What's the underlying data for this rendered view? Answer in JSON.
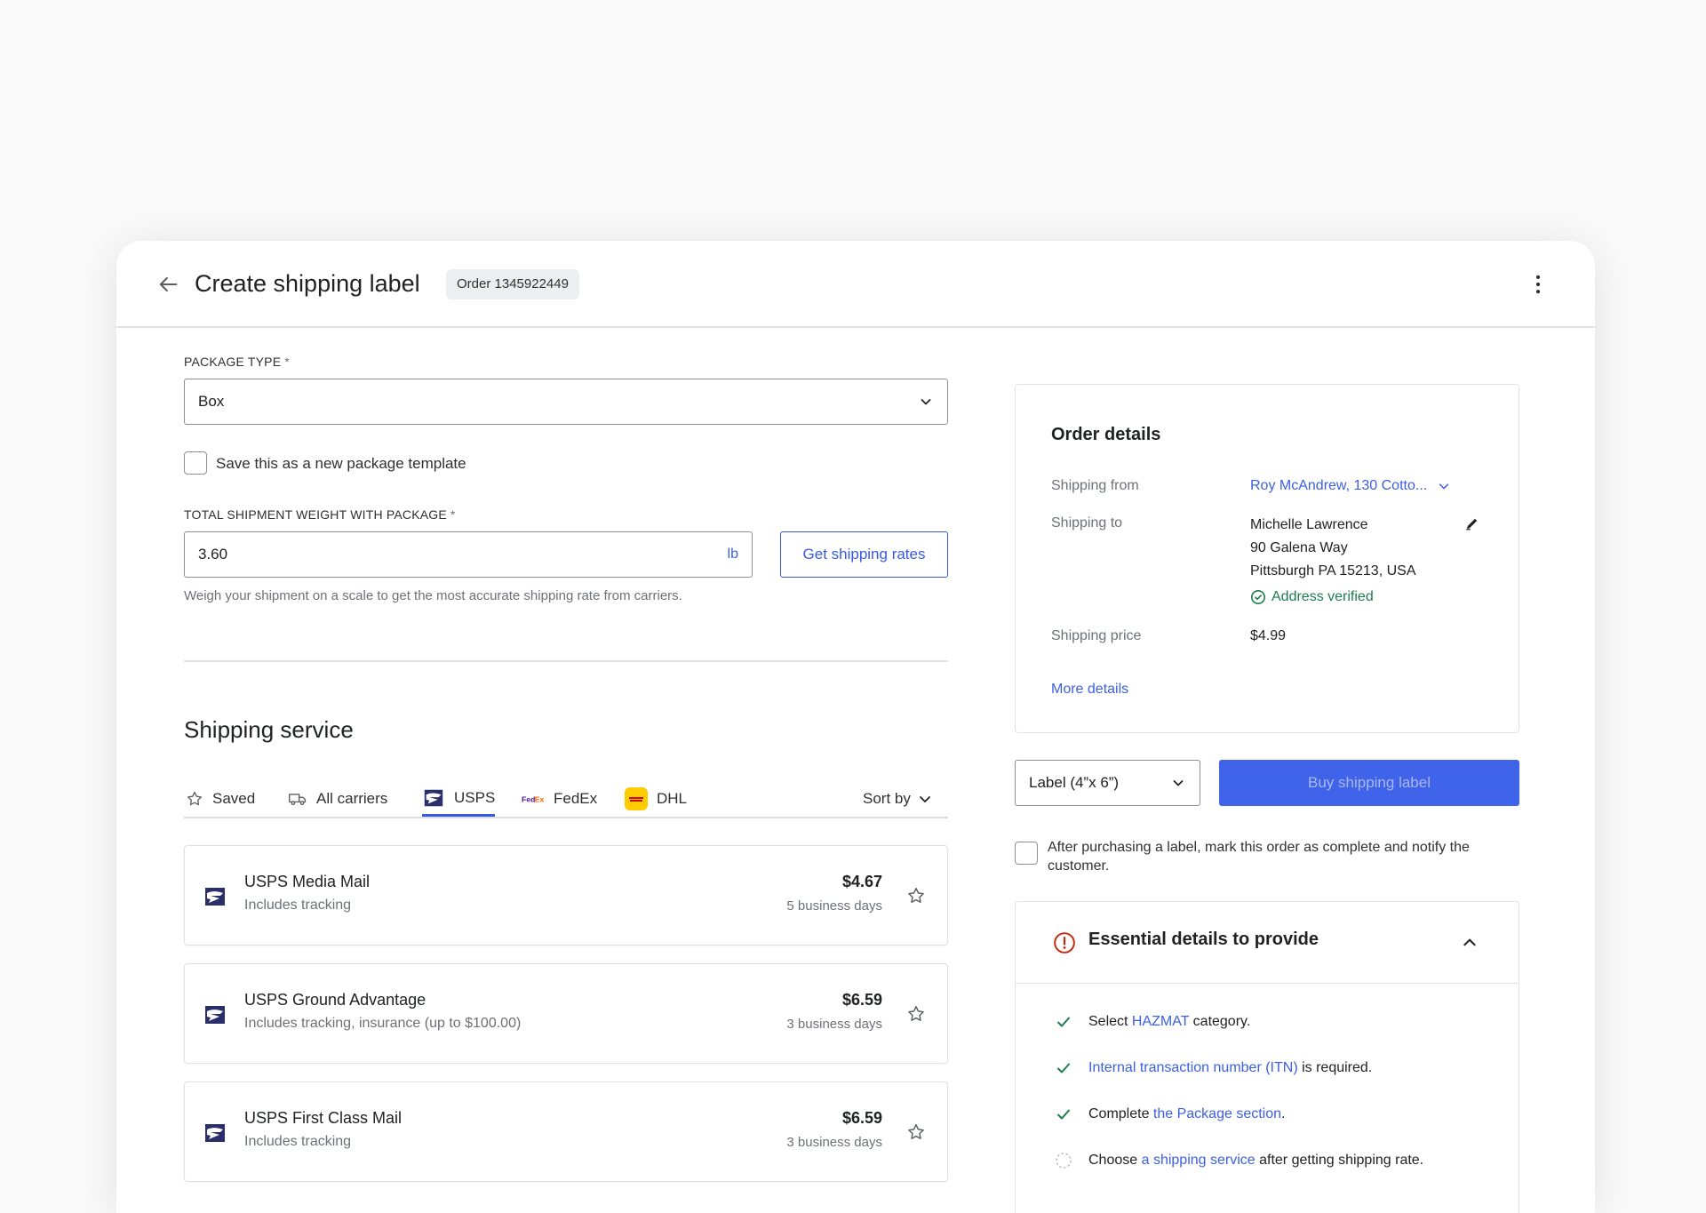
{
  "header": {
    "title": "Create shipping label",
    "order_badge": "Order 1345922449"
  },
  "package": {
    "type_label": "PACKAGE TYPE",
    "required_mark": "*",
    "type_value": "Box",
    "save_template_label": "Save this as a new package template",
    "weight_label": "TOTAL SHIPMENT WEIGHT WITH PACKAGE",
    "weight_value": "3.60",
    "weight_unit": "lb",
    "get_rates_label": "Get shipping rates",
    "weight_help": "Weigh your shipment on a scale to get the most accurate shipping rate from carriers."
  },
  "shipping_service": {
    "title": "Shipping service",
    "tabs": [
      {
        "label": "Saved",
        "icon": "star-icon"
      },
      {
        "label": "All carriers",
        "icon": "truck-icon"
      },
      {
        "label": "USPS",
        "icon": "usps-logo-icon"
      },
      {
        "label": "FedEx",
        "icon": "fedex-logo-icon"
      },
      {
        "label": "DHL",
        "icon": "dhl-logo-icon"
      }
    ],
    "active_tab": "USPS",
    "sort_label": "Sort by",
    "services": [
      {
        "name": "USPS Media Mail",
        "sub": "Includes tracking",
        "price": "$4.67",
        "days": "5 business days"
      },
      {
        "name": "USPS Ground Advantage",
        "sub": "Includes tracking, insurance (up to $100.00)",
        "price": "$6.59",
        "days": "3 business days"
      },
      {
        "name": "USPS First Class Mail",
        "sub": "Includes tracking",
        "price": "$6.59",
        "days": "3 business days"
      }
    ]
  },
  "order_details": {
    "title": "Order details",
    "shipping_from_label": "Shipping from",
    "shipping_from_value": "Roy McAndrew, 130 Cotto...",
    "shipping_to_label": "Shipping to",
    "shipping_to_lines": [
      "Michelle Lawrence",
      "90 Galena Way",
      "Pittsburgh PA 15213, USA"
    ],
    "address_verified": "Address verified",
    "shipping_price_label": "Shipping price",
    "shipping_price_value": "$4.99",
    "more_details": "More details"
  },
  "purchase": {
    "label_size": "Label (4”x 6”)",
    "buy_label": "Buy shipping label",
    "notify_note": "After purchasing a label, mark this order as complete and notify the customer."
  },
  "essential": {
    "title": "Essential details to provide",
    "items": [
      {
        "pre": "Select ",
        "link": "HAZMAT",
        "post": " category.",
        "done": true
      },
      {
        "pre": "",
        "link": "Internal transaction number (ITN)",
        "post": " is required.",
        "done": true
      },
      {
        "pre": "Complete ",
        "link": "the Package section",
        "post": ".",
        "done": true
      },
      {
        "pre": "Choose ",
        "link": "a shipping service",
        "post": " after getting shipping rate.",
        "done": false
      }
    ]
  },
  "colors": {
    "accent": "#3859e3",
    "primary_button": "#3f63e9",
    "success": "#1d7d4d",
    "critical": "#c5280c"
  }
}
